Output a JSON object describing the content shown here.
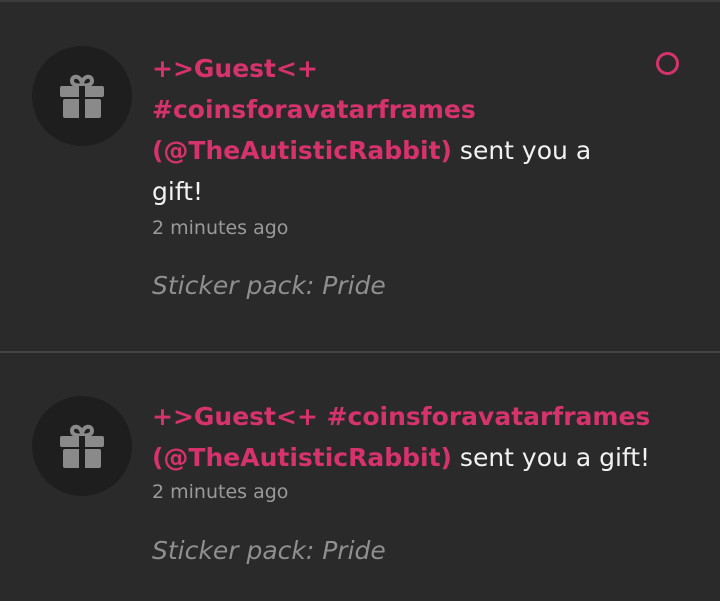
{
  "notifications": [
    {
      "sender": "+>Guest<+ #coinsforavatarframes (@TheAutisticRabbit)",
      "action": " sent you a gift!",
      "time": "2 minutes ago",
      "detail": "Sticker pack: Pride",
      "unread": true,
      "icon": "gift-icon"
    },
    {
      "sender": "+>Guest<+ #coinsforavatarframes (@TheAutisticRabbit)",
      "action": " sent you a gift!",
      "time": "2 minutes ago",
      "detail": "Sticker pack: Pride",
      "unread": false,
      "icon": "gift-icon"
    }
  ],
  "colors": {
    "accent": "#d6336c",
    "background": "#2a2a2b",
    "avatar_bg": "#1e1e1f",
    "text": "#f2f2f2",
    "muted": "#9a9a9a"
  }
}
